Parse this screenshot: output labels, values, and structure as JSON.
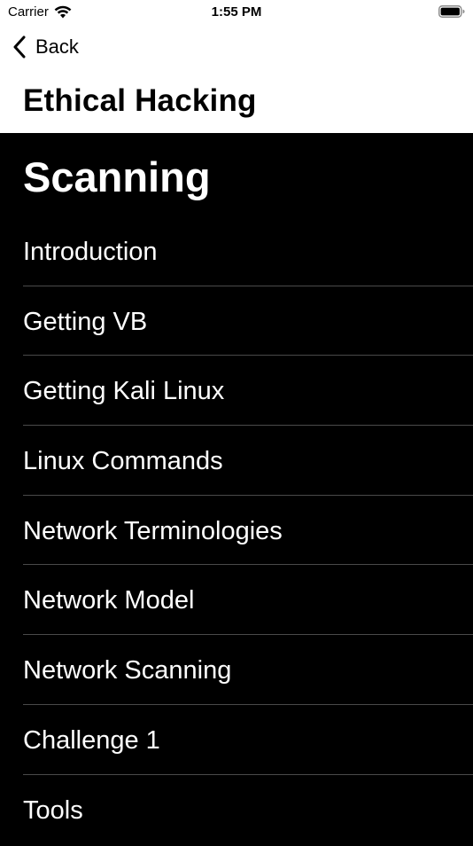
{
  "status_bar": {
    "carrier": "Carrier",
    "time": "1:55 PM"
  },
  "nav": {
    "back_label": "Back",
    "title": "Ethical Hacking"
  },
  "section": {
    "title": "Scanning"
  },
  "topics": [
    {
      "label": "Introduction"
    },
    {
      "label": "Getting VB"
    },
    {
      "label": "Getting Kali Linux"
    },
    {
      "label": "Linux Commands"
    },
    {
      "label": "Network Terminologies"
    },
    {
      "label": "Network Model"
    },
    {
      "label": "Network Scanning"
    },
    {
      "label": "Challenge 1"
    },
    {
      "label": "Tools"
    }
  ],
  "icons": {
    "wifi": "wifi-icon",
    "battery": "battery-icon",
    "back": "chevron-left-icon"
  },
  "colors": {
    "header_background": "#ffffff",
    "content_background": "#000000",
    "separator": "#4a4a4a"
  }
}
